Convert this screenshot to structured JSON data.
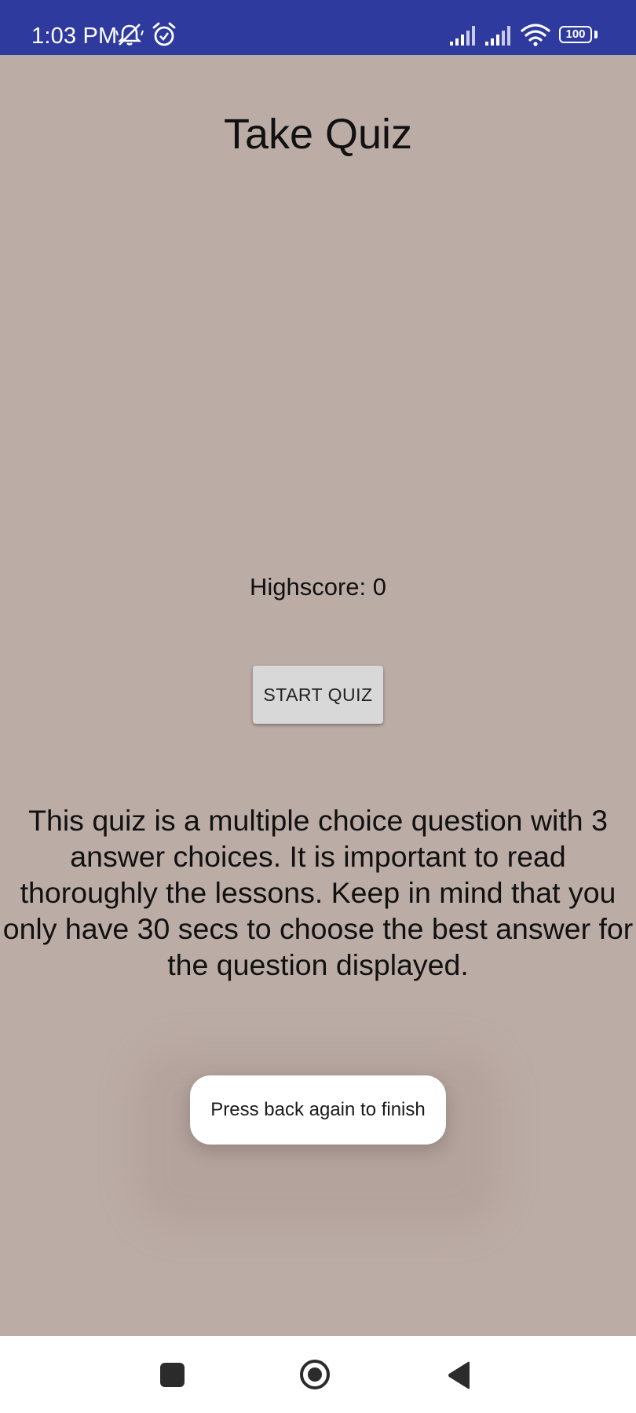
{
  "status_bar": {
    "time": "1:03 PM",
    "battery": "100",
    "icons": [
      "mute-icon",
      "alarm-icon",
      "signal-icon",
      "signal-icon",
      "wifi-icon",
      "battery-icon"
    ]
  },
  "main": {
    "title": "Take Quiz",
    "highscore": "Highscore: 0",
    "start_button": "START QUIZ",
    "description": "This quiz is a multiple choice question with 3 answer choices. It is important to read thoroughly the lessons. Keep in mind that you only have 30 secs to choose the best answer for the question displayed."
  },
  "toast": {
    "message": "Press back again to finish"
  },
  "nav_bar": {
    "icons": [
      "recents-icon",
      "home-icon",
      "back-icon"
    ]
  },
  "colors": {
    "status_bar": "#2e3a9e",
    "background": "#bcaca6",
    "button": "#d8d8d8",
    "toast": "#ffffff"
  }
}
